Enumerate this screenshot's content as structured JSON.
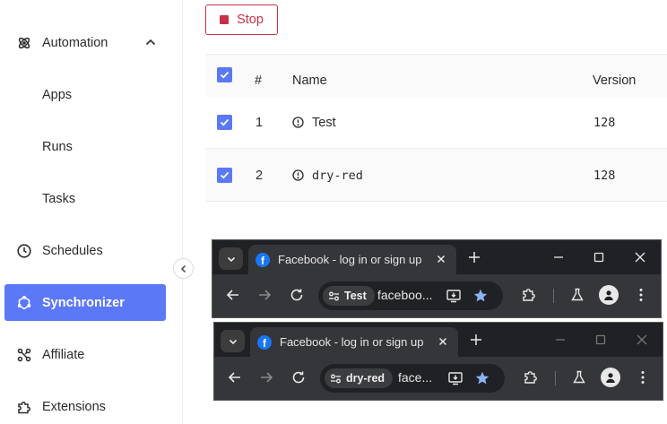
{
  "sidebar": {
    "items": [
      {
        "label": "Automation",
        "icon": "atom-icon"
      },
      {
        "label": "Apps"
      },
      {
        "label": "Runs"
      },
      {
        "label": "Tasks"
      },
      {
        "label": "Schedules",
        "icon": "clock-icon"
      },
      {
        "label": "Synchronizer",
        "icon": "sync-icon",
        "active": true
      },
      {
        "label": "Affiliate",
        "icon": "affiliate-icon"
      },
      {
        "label": "Extensions",
        "icon": "puzzle-icon"
      }
    ],
    "active_color": "#5b78f6"
  },
  "toolbar": {
    "stop_label": "Stop",
    "stop_color": "#c9304a"
  },
  "table": {
    "columns": [
      "#",
      "Name",
      "Version"
    ],
    "rows": [
      {
        "num": "1",
        "name": "Test",
        "version": "128"
      },
      {
        "num": "2",
        "name": "dry-red",
        "version": "128"
      }
    ]
  },
  "browsers": [
    {
      "tab_title": "Facebook - log in or sign up",
      "profile": "Test",
      "url": "faceboo..."
    },
    {
      "tab_title": "Facebook - log in or sign up",
      "profile": "dry-red",
      "url": "face..."
    }
  ]
}
